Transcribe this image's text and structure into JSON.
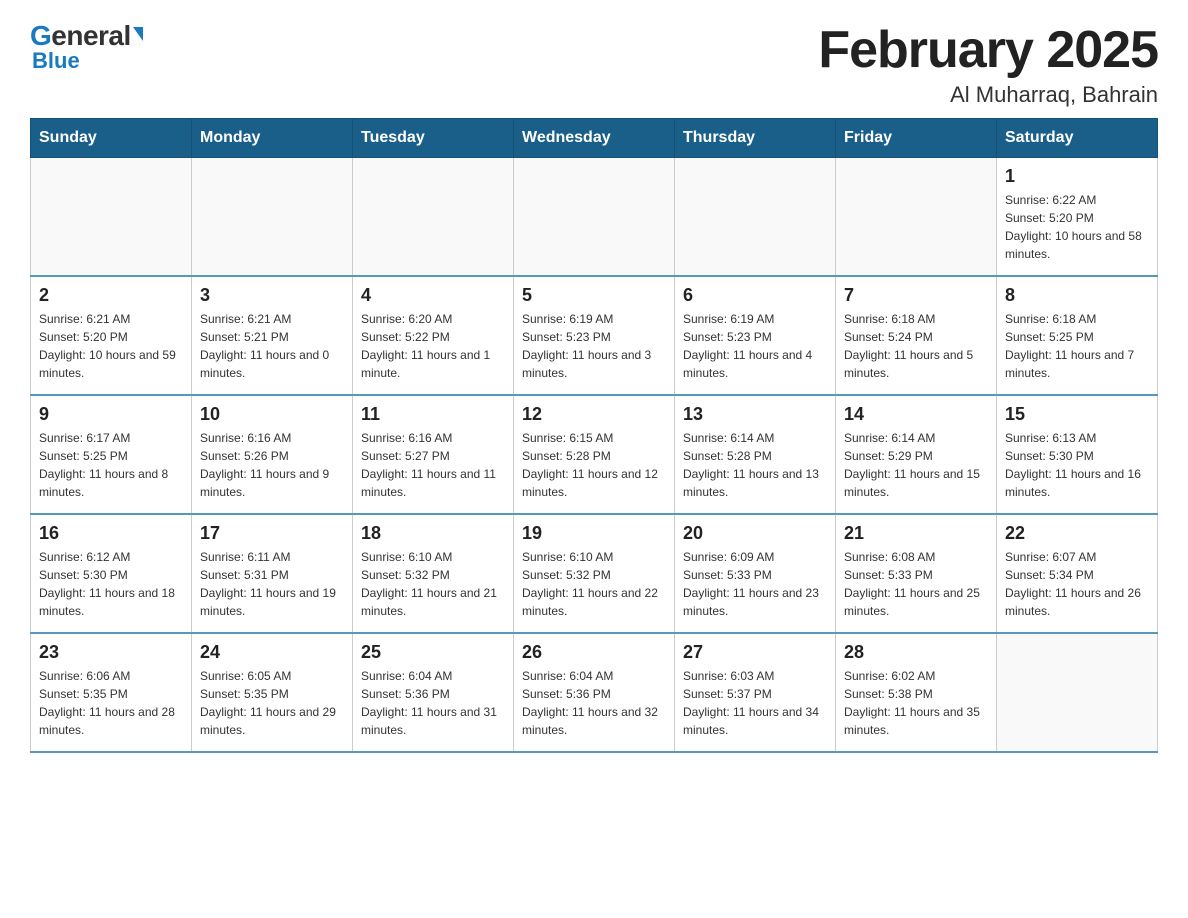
{
  "header": {
    "logo_general": "General",
    "logo_blue": "Blue",
    "title": "February 2025",
    "subtitle": "Al Muharraq, Bahrain"
  },
  "weekdays": [
    "Sunday",
    "Monday",
    "Tuesday",
    "Wednesday",
    "Thursday",
    "Friday",
    "Saturday"
  ],
  "weeks": [
    [
      {
        "day": "",
        "info": ""
      },
      {
        "day": "",
        "info": ""
      },
      {
        "day": "",
        "info": ""
      },
      {
        "day": "",
        "info": ""
      },
      {
        "day": "",
        "info": ""
      },
      {
        "day": "",
        "info": ""
      },
      {
        "day": "1",
        "info": "Sunrise: 6:22 AM\nSunset: 5:20 PM\nDaylight: 10 hours and 58 minutes."
      }
    ],
    [
      {
        "day": "2",
        "info": "Sunrise: 6:21 AM\nSunset: 5:20 PM\nDaylight: 10 hours and 59 minutes."
      },
      {
        "day": "3",
        "info": "Sunrise: 6:21 AM\nSunset: 5:21 PM\nDaylight: 11 hours and 0 minutes."
      },
      {
        "day": "4",
        "info": "Sunrise: 6:20 AM\nSunset: 5:22 PM\nDaylight: 11 hours and 1 minute."
      },
      {
        "day": "5",
        "info": "Sunrise: 6:19 AM\nSunset: 5:23 PM\nDaylight: 11 hours and 3 minutes."
      },
      {
        "day": "6",
        "info": "Sunrise: 6:19 AM\nSunset: 5:23 PM\nDaylight: 11 hours and 4 minutes."
      },
      {
        "day": "7",
        "info": "Sunrise: 6:18 AM\nSunset: 5:24 PM\nDaylight: 11 hours and 5 minutes."
      },
      {
        "day": "8",
        "info": "Sunrise: 6:18 AM\nSunset: 5:25 PM\nDaylight: 11 hours and 7 minutes."
      }
    ],
    [
      {
        "day": "9",
        "info": "Sunrise: 6:17 AM\nSunset: 5:25 PM\nDaylight: 11 hours and 8 minutes."
      },
      {
        "day": "10",
        "info": "Sunrise: 6:16 AM\nSunset: 5:26 PM\nDaylight: 11 hours and 9 minutes."
      },
      {
        "day": "11",
        "info": "Sunrise: 6:16 AM\nSunset: 5:27 PM\nDaylight: 11 hours and 11 minutes."
      },
      {
        "day": "12",
        "info": "Sunrise: 6:15 AM\nSunset: 5:28 PM\nDaylight: 11 hours and 12 minutes."
      },
      {
        "day": "13",
        "info": "Sunrise: 6:14 AM\nSunset: 5:28 PM\nDaylight: 11 hours and 13 minutes."
      },
      {
        "day": "14",
        "info": "Sunrise: 6:14 AM\nSunset: 5:29 PM\nDaylight: 11 hours and 15 minutes."
      },
      {
        "day": "15",
        "info": "Sunrise: 6:13 AM\nSunset: 5:30 PM\nDaylight: 11 hours and 16 minutes."
      }
    ],
    [
      {
        "day": "16",
        "info": "Sunrise: 6:12 AM\nSunset: 5:30 PM\nDaylight: 11 hours and 18 minutes."
      },
      {
        "day": "17",
        "info": "Sunrise: 6:11 AM\nSunset: 5:31 PM\nDaylight: 11 hours and 19 minutes."
      },
      {
        "day": "18",
        "info": "Sunrise: 6:10 AM\nSunset: 5:32 PM\nDaylight: 11 hours and 21 minutes."
      },
      {
        "day": "19",
        "info": "Sunrise: 6:10 AM\nSunset: 5:32 PM\nDaylight: 11 hours and 22 minutes."
      },
      {
        "day": "20",
        "info": "Sunrise: 6:09 AM\nSunset: 5:33 PM\nDaylight: 11 hours and 23 minutes."
      },
      {
        "day": "21",
        "info": "Sunrise: 6:08 AM\nSunset: 5:33 PM\nDaylight: 11 hours and 25 minutes."
      },
      {
        "day": "22",
        "info": "Sunrise: 6:07 AM\nSunset: 5:34 PM\nDaylight: 11 hours and 26 minutes."
      }
    ],
    [
      {
        "day": "23",
        "info": "Sunrise: 6:06 AM\nSunset: 5:35 PM\nDaylight: 11 hours and 28 minutes."
      },
      {
        "day": "24",
        "info": "Sunrise: 6:05 AM\nSunset: 5:35 PM\nDaylight: 11 hours and 29 minutes."
      },
      {
        "day": "25",
        "info": "Sunrise: 6:04 AM\nSunset: 5:36 PM\nDaylight: 11 hours and 31 minutes."
      },
      {
        "day": "26",
        "info": "Sunrise: 6:04 AM\nSunset: 5:36 PM\nDaylight: 11 hours and 32 minutes."
      },
      {
        "day": "27",
        "info": "Sunrise: 6:03 AM\nSunset: 5:37 PM\nDaylight: 11 hours and 34 minutes."
      },
      {
        "day": "28",
        "info": "Sunrise: 6:02 AM\nSunset: 5:38 PM\nDaylight: 11 hours and 35 minutes."
      },
      {
        "day": "",
        "info": ""
      }
    ]
  ]
}
